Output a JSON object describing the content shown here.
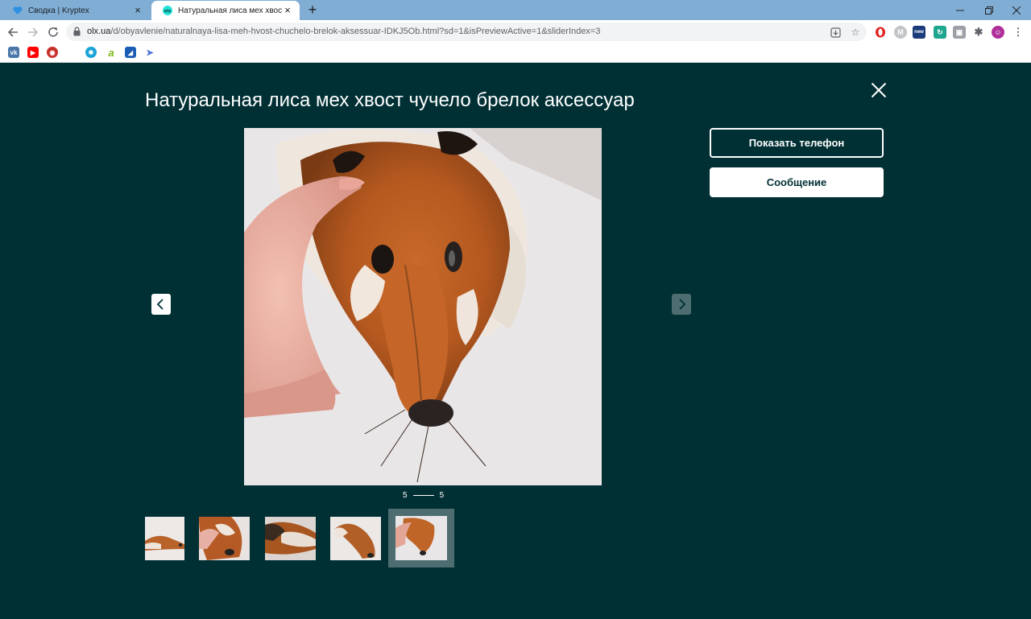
{
  "browser": {
    "tabs": [
      {
        "title": "Сводка | Kryptex",
        "icon": "kryptex-heart-icon",
        "active": false
      },
      {
        "title": "Натуральная лиса мех хвост чучело брелок аксессуар",
        "icon": "olx-icon",
        "active": true
      }
    ],
    "url_host": "olx.ua",
    "url_path": "/d/obyavlenie/naturalnaya-lisa-meh-hvost-chuchelo-brelok-aksessuar-IDKJ5Ob.html?sd=1&isPreviewActive=1&sliderIndex=3",
    "bookmarks": [
      "vk-icon",
      "youtube-icon",
      "app-icon",
      "apple-icon",
      "globe-icon",
      "a-icon",
      "bookmark-icon",
      "arrow-icon"
    ],
    "extensions": [
      "opera-icon",
      "m-icon",
      "new-icon",
      "refresh-ext-icon",
      "profile-icon",
      "puzzle-icon",
      "avatar-icon"
    ]
  },
  "gallery": {
    "title": "Натуральная лиса мех хвост чучело брелок аксессуар",
    "counter_current": "5",
    "counter_total": "5",
    "active_index": 4,
    "thumbnails": 5
  },
  "actions": {
    "phone_label": "Показать телефон",
    "message_label": "Сообщение"
  },
  "colors": {
    "background": "#002f34",
    "arrow_disabled": "#4d6d71",
    "tabbar": "#7fadd4"
  }
}
